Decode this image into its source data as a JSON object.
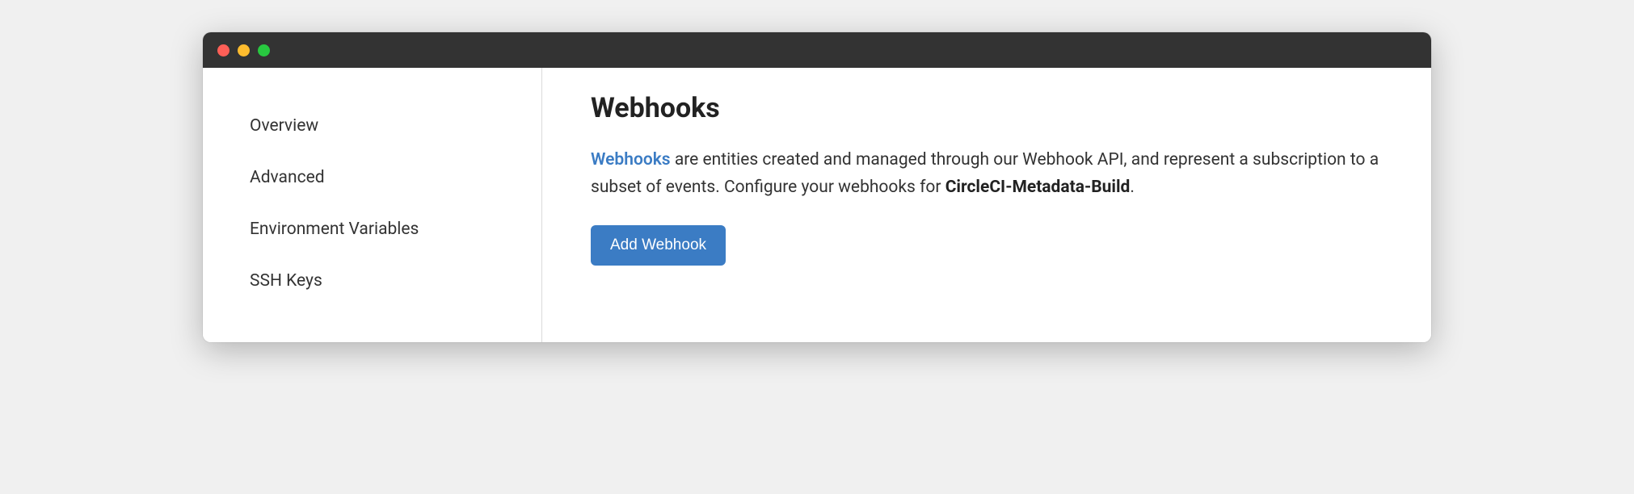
{
  "sidebar": {
    "items": [
      {
        "label": "Overview"
      },
      {
        "label": "Advanced"
      },
      {
        "label": "Environment Variables"
      },
      {
        "label": "SSH Keys"
      }
    ]
  },
  "main": {
    "title": "Webhooks",
    "link_text": "Webhooks",
    "description_mid": " are entities created and managed through our Webhook API, and represent a subscription to a subset of events. Configure your webhooks for ",
    "project_name": "CircleCI-Metadata-Build",
    "description_end": ".",
    "add_button_label": "Add Webhook"
  }
}
